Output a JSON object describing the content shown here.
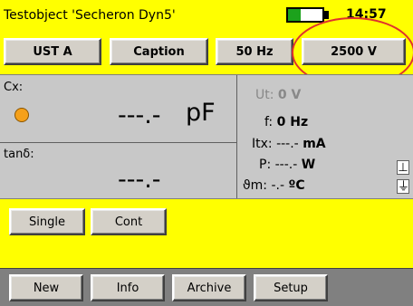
{
  "header": {
    "title": "Testobject 'Secheron Dyn5'",
    "time": "14:57",
    "battery_level": 0.38,
    "battery_color": "#1ca21c"
  },
  "toolbar": {
    "mode": "UST A",
    "caption": "Caption",
    "frequency": "50 Hz",
    "voltage": "2500 V"
  },
  "highlight_color": "#e0312d",
  "measurement": {
    "cx_label": "Cx:",
    "cx_value": "---.-",
    "cx_unit": "pF",
    "tan_label": "tanδ:",
    "tan_value": "---.-",
    "ut_label": "Ut:",
    "ut_value": "0 V",
    "f_label": "f:",
    "f_value": "0 Hz",
    "itx_label": "Itx:",
    "itx_value": "---.-",
    "itx_unit": "mA",
    "p_label": "P:",
    "p_value": "---.-",
    "p_unit": "W",
    "theta_label": "ϑm:",
    "theta_value": "-.-",
    "theta_unit": "ºC",
    "status_color": "#f5a019",
    "icons": [
      "capacitor-icon",
      "ground-icon"
    ]
  },
  "mode_buttons": {
    "single": "Single",
    "cont": "Cont"
  },
  "footer": {
    "new": "New",
    "info": "Info",
    "archive": "Archive",
    "setup": "Setup"
  }
}
